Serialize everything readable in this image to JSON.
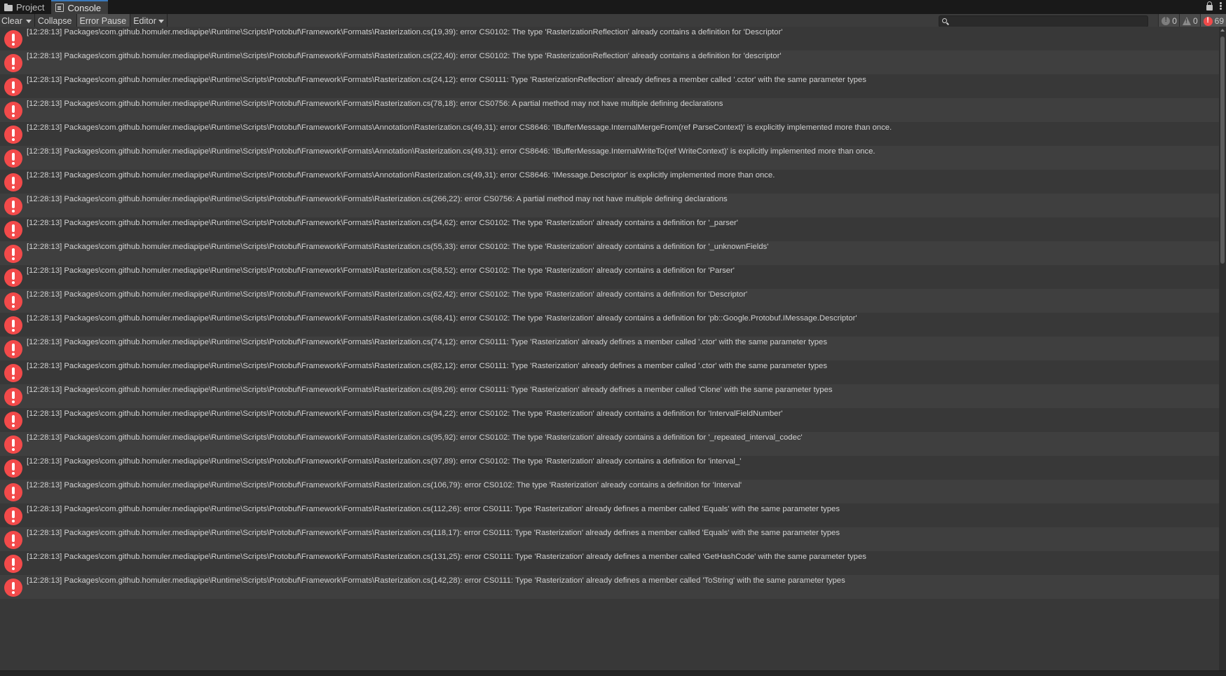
{
  "tabs": [
    {
      "label": "Project",
      "icon": "folder-icon"
    },
    {
      "label": "Console",
      "icon": "console-icon"
    }
  ],
  "toolbar": {
    "clear_label": "Clear",
    "collapse_label": "Collapse",
    "error_pause_label": "Error Pause",
    "editor_label": "Editor",
    "search_placeholder": "",
    "search_value": ""
  },
  "counters": {
    "info_count": "0",
    "warning_count": "0",
    "error_count": "69"
  },
  "colors": {
    "accent": "#3a79bb",
    "error": "#f24a4a",
    "background": "#383838"
  },
  "logs": [
    "[12:28:13] Packages\\com.github.homuler.mediapipe\\Runtime\\Scripts\\Protobuf\\Framework\\Formats\\Rasterization.cs(19,39): error CS0102: The type 'RasterizationReflection' already contains a definition for 'Descriptor'",
    "[12:28:13] Packages\\com.github.homuler.mediapipe\\Runtime\\Scripts\\Protobuf\\Framework\\Formats\\Rasterization.cs(22,40): error CS0102: The type 'RasterizationReflection' already contains a definition for 'descriptor'",
    "[12:28:13] Packages\\com.github.homuler.mediapipe\\Runtime\\Scripts\\Protobuf\\Framework\\Formats\\Rasterization.cs(24,12): error CS0111: Type 'RasterizationReflection' already defines a member called '.cctor' with the same parameter types",
    "[12:28:13] Packages\\com.github.homuler.mediapipe\\Runtime\\Scripts\\Protobuf\\Framework\\Formats\\Rasterization.cs(78,18): error CS0756: A partial method may not have multiple defining declarations",
    "[12:28:13] Packages\\com.github.homuler.mediapipe\\Runtime\\Scripts\\Protobuf\\Framework\\Formats\\Annotation\\Rasterization.cs(49,31): error CS8646: 'IBufferMessage.InternalMergeFrom(ref ParseContext)' is explicitly implemented more than once.",
    "[12:28:13] Packages\\com.github.homuler.mediapipe\\Runtime\\Scripts\\Protobuf\\Framework\\Formats\\Annotation\\Rasterization.cs(49,31): error CS8646: 'IBufferMessage.InternalWriteTo(ref WriteContext)' is explicitly implemented more than once.",
    "[12:28:13] Packages\\com.github.homuler.mediapipe\\Runtime\\Scripts\\Protobuf\\Framework\\Formats\\Annotation\\Rasterization.cs(49,31): error CS8646: 'IMessage.Descriptor' is explicitly implemented more than once.",
    "[12:28:13] Packages\\com.github.homuler.mediapipe\\Runtime\\Scripts\\Protobuf\\Framework\\Formats\\Rasterization.cs(266,22): error CS0756: A partial method may not have multiple defining declarations",
    "[12:28:13] Packages\\com.github.homuler.mediapipe\\Runtime\\Scripts\\Protobuf\\Framework\\Formats\\Rasterization.cs(54,62): error CS0102: The type 'Rasterization' already contains a definition for '_parser'",
    "[12:28:13] Packages\\com.github.homuler.mediapipe\\Runtime\\Scripts\\Protobuf\\Framework\\Formats\\Rasterization.cs(55,33): error CS0102: The type 'Rasterization' already contains a definition for '_unknownFields'",
    "[12:28:13] Packages\\com.github.homuler.mediapipe\\Runtime\\Scripts\\Protobuf\\Framework\\Formats\\Rasterization.cs(58,52): error CS0102: The type 'Rasterization' already contains a definition for 'Parser'",
    "[12:28:13] Packages\\com.github.homuler.mediapipe\\Runtime\\Scripts\\Protobuf\\Framework\\Formats\\Rasterization.cs(62,42): error CS0102: The type 'Rasterization' already contains a definition for 'Descriptor'",
    "[12:28:13] Packages\\com.github.homuler.mediapipe\\Runtime\\Scripts\\Protobuf\\Framework\\Formats\\Rasterization.cs(68,41): error CS0102: The type 'Rasterization' already contains a definition for 'pb::Google.Protobuf.IMessage.Descriptor'",
    "[12:28:13] Packages\\com.github.homuler.mediapipe\\Runtime\\Scripts\\Protobuf\\Framework\\Formats\\Rasterization.cs(74,12): error CS0111: Type 'Rasterization' already defines a member called '.ctor' with the same parameter types",
    "[12:28:13] Packages\\com.github.homuler.mediapipe\\Runtime\\Scripts\\Protobuf\\Framework\\Formats\\Rasterization.cs(82,12): error CS0111: Type 'Rasterization' already defines a member called '.ctor' with the same parameter types",
    "[12:28:13] Packages\\com.github.homuler.mediapipe\\Runtime\\Scripts\\Protobuf\\Framework\\Formats\\Rasterization.cs(89,26): error CS0111: Type 'Rasterization' already defines a member called 'Clone' with the same parameter types",
    "[12:28:13] Packages\\com.github.homuler.mediapipe\\Runtime\\Scripts\\Protobuf\\Framework\\Formats\\Rasterization.cs(94,22): error CS0102: The type 'Rasterization' already contains a definition for 'IntervalFieldNumber'",
    "[12:28:13] Packages\\com.github.homuler.mediapipe\\Runtime\\Scripts\\Protobuf\\Framework\\Formats\\Rasterization.cs(95,92): error CS0102: The type 'Rasterization' already contains a definition for '_repeated_interval_codec'",
    "[12:28:13] Packages\\com.github.homuler.mediapipe\\Runtime\\Scripts\\Protobuf\\Framework\\Formats\\Rasterization.cs(97,89): error CS0102: The type 'Rasterization' already contains a definition for 'interval_'",
    "[12:28:13] Packages\\com.github.homuler.mediapipe\\Runtime\\Scripts\\Protobuf\\Framework\\Formats\\Rasterization.cs(106,79): error CS0102: The type 'Rasterization' already contains a definition for 'Interval'",
    "[12:28:13] Packages\\com.github.homuler.mediapipe\\Runtime\\Scripts\\Protobuf\\Framework\\Formats\\Rasterization.cs(112,26): error CS0111: Type 'Rasterization' already defines a member called 'Equals' with the same parameter types",
    "[12:28:13] Packages\\com.github.homuler.mediapipe\\Runtime\\Scripts\\Protobuf\\Framework\\Formats\\Rasterization.cs(118,17): error CS0111: Type 'Rasterization' already defines a member called 'Equals' with the same parameter types",
    "[12:28:13] Packages\\com.github.homuler.mediapipe\\Runtime\\Scripts\\Protobuf\\Framework\\Formats\\Rasterization.cs(131,25): error CS0111: Type 'Rasterization' already defines a member called 'GetHashCode' with the same parameter types",
    "[12:28:13] Packages\\com.github.homuler.mediapipe\\Runtime\\Scripts\\Protobuf\\Framework\\Formats\\Rasterization.cs(142,28): error CS0111: Type 'Rasterization' already defines a member called 'ToString' with the same parameter types"
  ]
}
